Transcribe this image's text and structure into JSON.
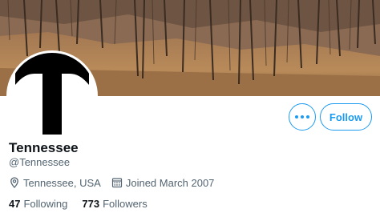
{
  "profile": {
    "display_name": "Tennessee",
    "handle": "@Tennessee",
    "location": "Tennessee, USA",
    "joined": "Joined March 2007",
    "avatar_letter": "T"
  },
  "stats": {
    "following_count": "47",
    "following_label": "Following",
    "followers_count": "773",
    "followers_label": "Followers"
  },
  "actions": {
    "follow_label": "Follow"
  },
  "icons": {
    "more": "more-horizontal-icon",
    "location": "location-pin-icon",
    "calendar": "calendar-icon"
  },
  "colors": {
    "accent": "#1d9bf0",
    "text_primary": "#0f1419",
    "text_secondary": "#536471"
  }
}
